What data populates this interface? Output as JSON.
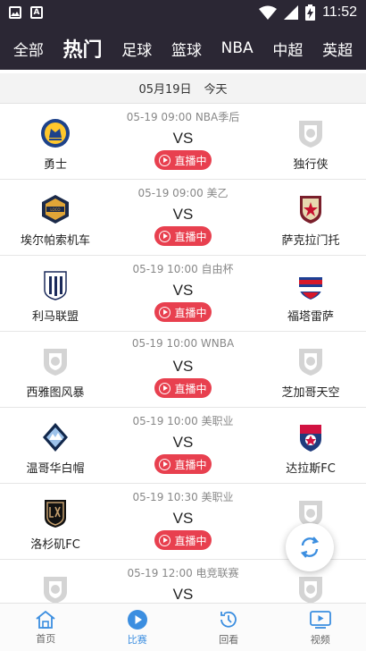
{
  "status_bar": {
    "time": "11:52"
  },
  "top_tabs": [
    {
      "label": "全部",
      "active": false
    },
    {
      "label": "热门",
      "active": true
    },
    {
      "label": "足球",
      "active": false
    },
    {
      "label": "篮球",
      "active": false
    },
    {
      "label": "NBA",
      "active": false
    },
    {
      "label": "中超",
      "active": false
    },
    {
      "label": "英超",
      "active": false
    }
  ],
  "date_header": {
    "date": "05月19日",
    "day": "今天"
  },
  "live_label": "直播中",
  "vs_label": "VS",
  "matches": [
    {
      "meta": "05-19 09:00 NBA季后",
      "home": "勇士",
      "away": "独行侠",
      "home_logo": "warriors-logo",
      "away_logo": "shield-placeholder-logo"
    },
    {
      "meta": "05-19 09:00 美乙",
      "home": "埃尔帕索机车",
      "away": "萨克拉门托",
      "home_logo": "locomotive-logo",
      "away_logo": "republic-logo"
    },
    {
      "meta": "05-19 10:00 自由杯",
      "home": "利马联盟",
      "away": "福塔雷萨",
      "home_logo": "alianza-lima-logo",
      "away_logo": "fortaleza-logo"
    },
    {
      "meta": "05-19 10:00 WNBA",
      "home": "西雅图风暴",
      "away": "芝加哥天空",
      "home_logo": "shield-placeholder-logo",
      "away_logo": "shield-placeholder-logo"
    },
    {
      "meta": "05-19 10:00 美职业",
      "home": "温哥华白帽",
      "away": "达拉斯FC",
      "home_logo": "whitecaps-logo",
      "away_logo": "fc-dallas-logo"
    },
    {
      "meta": "05-19 10:30 美职业",
      "home": "洛杉矶FC",
      "away": "",
      "home_logo": "lafc-logo",
      "away_logo": "shield-placeholder-logo"
    },
    {
      "meta": "05-19 12:00 电竞联赛",
      "home": "",
      "away": "",
      "home_logo": "shield-placeholder-logo",
      "away_logo": "shield-placeholder-logo"
    }
  ],
  "bottom_nav": [
    {
      "label": "首页",
      "icon": "home-icon",
      "active": false
    },
    {
      "label": "比赛",
      "icon": "play-circle-icon",
      "active": true
    },
    {
      "label": "回看",
      "icon": "replay-clock-icon",
      "active": false
    },
    {
      "label": "视频",
      "icon": "video-icon",
      "active": false
    }
  ],
  "colors": {
    "header_bg": "#2b2734",
    "live_red": "#e8404f",
    "active_blue": "#3b8ee0"
  }
}
